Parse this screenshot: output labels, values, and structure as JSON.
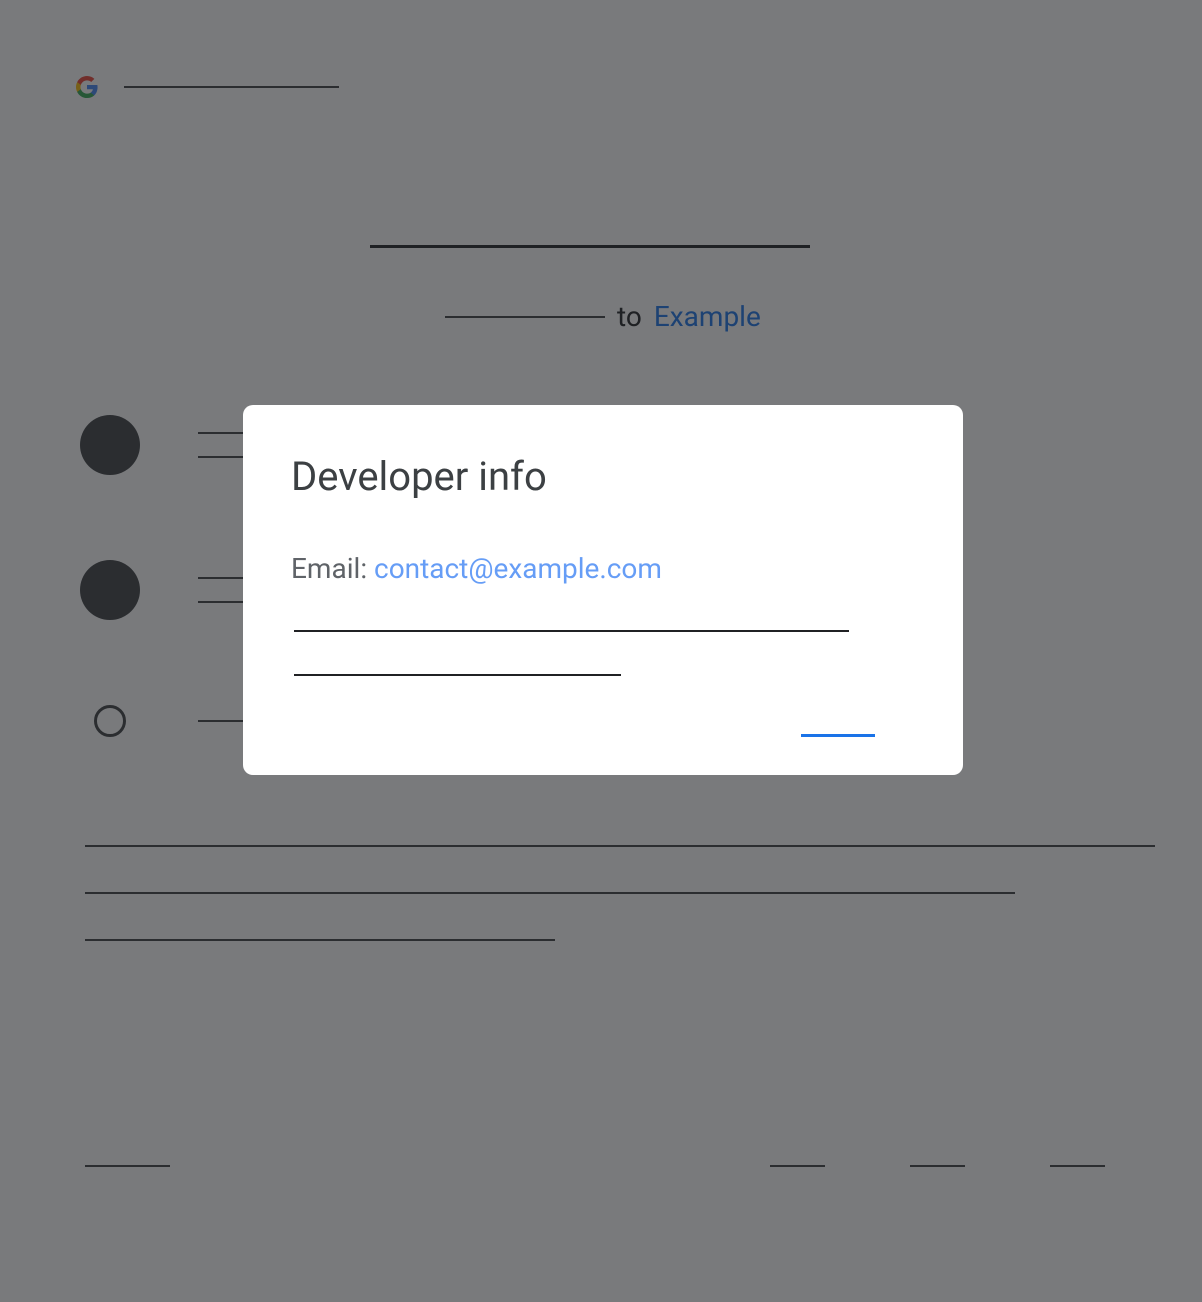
{
  "background": {
    "subtitle_to": "to",
    "subtitle_app": "Example"
  },
  "modal": {
    "title": "Developer info",
    "email_label": "Email: ",
    "email_value": "contact@example.com"
  }
}
